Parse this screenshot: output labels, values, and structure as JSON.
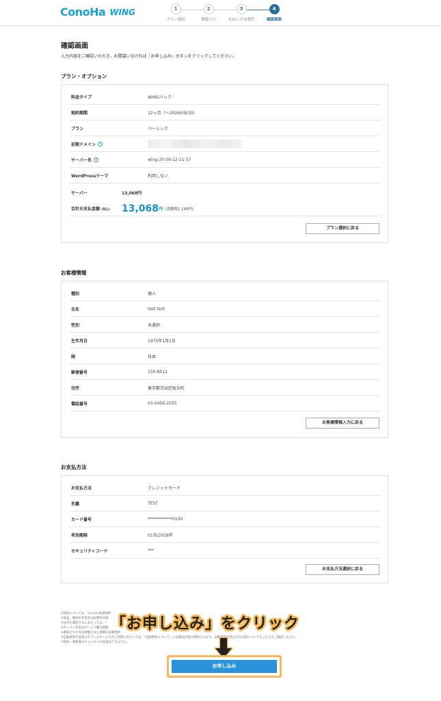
{
  "header": {
    "logo_main": "ConoHa",
    "logo_sub": "WING",
    "steps": [
      {
        "num": "1",
        "label": "プラン選択"
      },
      {
        "num": "2",
        "label": "情報入力"
      },
      {
        "num": "3",
        "label": "支払い方法選択"
      },
      {
        "num": "4",
        "label": "確認画面"
      }
    ]
  },
  "page": {
    "title": "確認画面",
    "description": "入力内容をご確認いただき、お間違いなければ「お申し込み」ボタンをクリックしてください。"
  },
  "plan": {
    "title": "プラン・オプション",
    "rows": [
      {
        "label": "料金タイプ",
        "value": "WINGパック"
      },
      {
        "label": "契約期間",
        "value": "12ヶ月（〜2026/09/30）"
      },
      {
        "label": "プラン",
        "value": "ベーシック"
      },
      {
        "label": "初期ドメイン",
        "value": ""
      },
      {
        "label": "サーバー名",
        "value": "wing-25-09-12-11-37"
      },
      {
        "label": "WordPressテーマ",
        "value": "利用しない"
      }
    ],
    "server_label": "サーバー",
    "server_price": "13,068円",
    "total_label": "合計お支払金額",
    "total_tax_label": "(税込)",
    "total_amount": "13,068",
    "total_yen": "円",
    "total_tax_note": "(消費税1,188円)",
    "back_button": "プラン選択に戻る"
  },
  "customer": {
    "title": "お客様情報",
    "rows": [
      {
        "label": "種別",
        "value": "個人"
      },
      {
        "label": "氏名",
        "value": "test test"
      },
      {
        "label": "性別",
        "value": "未選択"
      },
      {
        "label": "生年月日",
        "value": "1975年1月1日"
      },
      {
        "label": "国",
        "value": "日本"
      },
      {
        "label": "郵便番号",
        "value": "150-8512"
      },
      {
        "label": "住所",
        "value": "東京都渋谷区桜丘町"
      },
      {
        "label": "電話番号",
        "value": "03-5456-2555"
      }
    ],
    "back_button": "お客様情報入力に戻る"
  },
  "payment": {
    "title": "お支払方法",
    "rows": [
      {
        "label": "お支払方法",
        "value": "クレジットカード"
      },
      {
        "label": "名義",
        "value": "TEST"
      },
      {
        "label": "カード番号",
        "value": "************0100"
      },
      {
        "label": "有効期限",
        "value": "01月/2028年"
      },
      {
        "label": "セキュリティコード",
        "value": "***"
      }
    ],
    "back_button": "お支払方法選択に戻る"
  },
  "notes": [
    "※契約については、ConoHa会員規約",
    "※商品、権利の代金又は役務の対価",
    "※注文を確定するにあたっては、「",
    "※サーバー料金はサービス種別期間",
    "※選択された有効期間と同じ期間の自動更新",
    "※自動更新が設定されているサービスのご利用にあたっては、「自動更新について」に記載の内容が適用されます。自動更新の停止の方法等についてもこちらをご確認ください。",
    "※契約・更新後のキャンセルや返金はできません。"
  ],
  "callout": "「お申し込み」をクリック",
  "submit_button": "お申し込み"
}
